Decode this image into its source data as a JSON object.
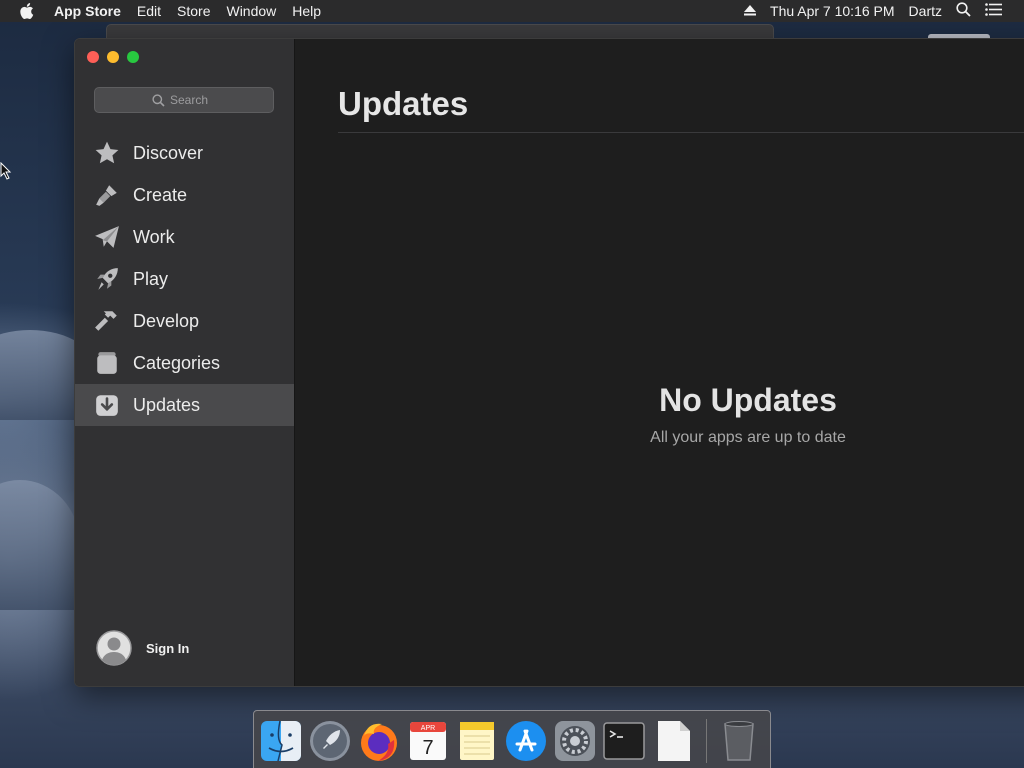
{
  "menubar": {
    "app_name": "App Store",
    "menus": [
      "Edit",
      "Store",
      "Window",
      "Help"
    ],
    "clock": "Thu Apr 7  10:16 PM",
    "user": "Dartz"
  },
  "sidebar": {
    "search_placeholder": "Search",
    "items": [
      {
        "label": "Discover",
        "icon": "star-icon"
      },
      {
        "label": "Create",
        "icon": "brush-icon"
      },
      {
        "label": "Work",
        "icon": "paper-plane-icon"
      },
      {
        "label": "Play",
        "icon": "rocket-icon"
      },
      {
        "label": "Develop",
        "icon": "hammer-icon"
      },
      {
        "label": "Categories",
        "icon": "stack-icon"
      },
      {
        "label": "Updates",
        "icon": "download-icon",
        "active": true
      }
    ],
    "sign_in": "Sign In"
  },
  "main": {
    "title": "Updates",
    "empty_title": "No Updates",
    "empty_subtitle": "All your apps are up to date"
  },
  "dock": {
    "apps": [
      "finder-icon",
      "launchpad-icon",
      "firefox-icon",
      "calendar-icon",
      "notes-icon",
      "app-store-icon",
      "system-preferences-icon",
      "terminal-icon",
      "document-icon",
      "trash-icon"
    ],
    "calendar_month": "APR",
    "calendar_day": "7"
  },
  "colors": {
    "sidebar_bg": "#313133",
    "main_bg": "#1e1e1e",
    "active_item": "#4a4a4c",
    "close": "#fe5f57",
    "minimize": "#febc2e",
    "zoom": "#28c840"
  }
}
